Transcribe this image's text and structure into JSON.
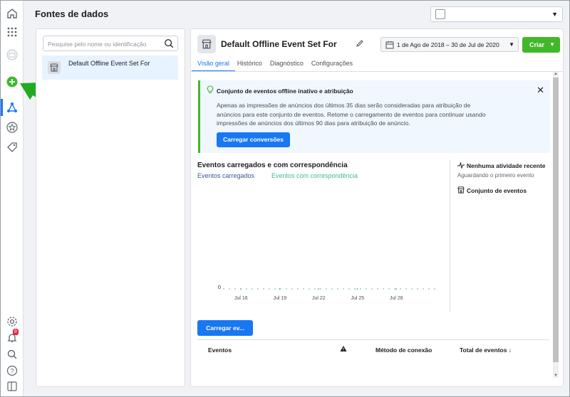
{
  "header": {
    "title": "Fontes de dados",
    "select_value": ""
  },
  "left_panel": {
    "search_placeholder": "Pesquise pelo nome ou identificação",
    "items": [
      {
        "label": "Default Offline Event Set For"
      }
    ]
  },
  "main": {
    "title": "Default Offline Event Set For",
    "date_range": "1 de Ago de 2018 – 30 de Jul de 2020",
    "create_label": "Criar",
    "tabs": [
      {
        "label": "Visão geral",
        "active": true
      },
      {
        "label": "Histórico",
        "active": false
      },
      {
        "label": "Diagnóstico",
        "active": false
      },
      {
        "label": "Configurações",
        "active": false
      }
    ],
    "banner": {
      "title": "Conjunto de eventos offline inativo e atribuição",
      "body": "Apenas as impressões de anúncios dos últimos 35 dias serão consideradas para atribuição de anúncios para este conjunto de eventos. Retome o carregamento de eventos para continuar usando impressões de anúncios dos últimos 90 dias para atribuição de anúncio.",
      "button_label": "Carregar conversões"
    },
    "chart": {
      "title": "Eventos carregados e com correspondência",
      "legend_uploaded": "Eventos carregados",
      "legend_matched": "Eventos com correspondência"
    },
    "side": {
      "activity_title": "Nenhuma atividade recente",
      "activity_sub": "Aguardando o primeiro evento",
      "event_set_label": "Conjunto de eventos"
    },
    "upload_button": "Carregar ev...",
    "table_headers": {
      "events": "Eventos",
      "connection_method": "Método de conexão",
      "total_events": "Total de eventos ↓"
    }
  },
  "chart_data": {
    "type": "line",
    "title": "Eventos carregados e com correspondência",
    "categories": [
      "Jul 16",
      "Jul 19",
      "Jul 22",
      "Jul 25",
      "Jul 28"
    ],
    "series": [
      {
        "name": "Eventos carregados",
        "values": [
          0,
          0,
          0,
          0,
          0
        ]
      },
      {
        "name": "Eventos com correspondência",
        "values": [
          0,
          0,
          0,
          0,
          0
        ]
      }
    ],
    "y_tick": "0",
    "colors": {
      "uploaded": "#385898",
      "matched": "#3db89b"
    }
  },
  "colors": {
    "accent": "#1877f2",
    "create_green": "#42b72a",
    "annotation_arrow": "#22aa22"
  }
}
